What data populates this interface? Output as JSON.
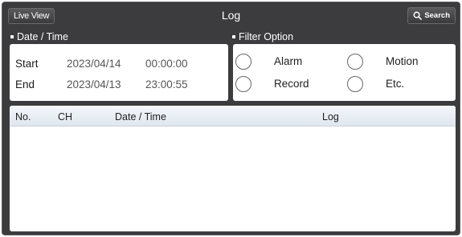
{
  "header": {
    "live_view_label": "Live View",
    "title": "Log",
    "search_label": "Search",
    "search_icon": "search-icon"
  },
  "date_time": {
    "section_label": "Date / Time",
    "start_label": "Start",
    "start_date": "2023/04/14",
    "start_time": "00:00:00",
    "end_label": "End",
    "end_date": "2023/04/13",
    "end_time": "23:00:55"
  },
  "filter": {
    "section_label": "Filter Option",
    "options": [
      {
        "label": "Alarm",
        "checked": false
      },
      {
        "label": "Motion",
        "checked": false
      },
      {
        "label": "Record",
        "checked": false
      },
      {
        "label": "Etc.",
        "checked": false
      }
    ]
  },
  "log_table": {
    "columns": [
      "No.",
      "CH",
      "Date / Time",
      "Log"
    ],
    "rows": []
  },
  "colors": {
    "frame": "#3c3c3e",
    "header_row": "#dfe6ef"
  }
}
